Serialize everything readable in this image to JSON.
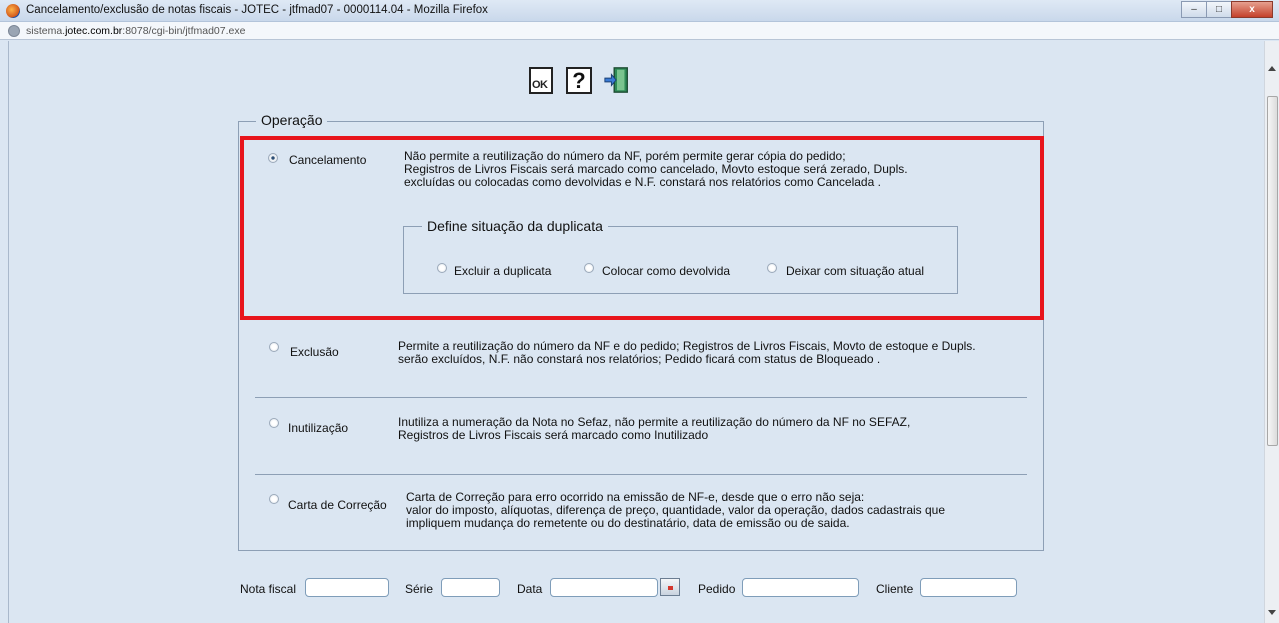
{
  "window": {
    "title": "Cancelamento/exclusão de notas fiscais - JOTEC - jtfmad07 - 0000114.04 - Mozilla Firefox",
    "url_prefix": "sistema.",
    "url_domain": "jotec.com.br",
    "url_suffix": ":8078/cgi-bin/jtfmad07.exe"
  },
  "toolbar": {
    "ok_label": "OK",
    "help_label": "?"
  },
  "operacao": {
    "legend": "Operação",
    "cancelamento": {
      "label": "Cancelamento",
      "checked": true,
      "desc": [
        "Não permite a reutilização do número da NF, porém permite gerar cópia do pedido;",
        "Registros de Livros Fiscais será marcado como cancelado, Movto estoque será zerado, Dupls.",
        "excluídas ou colocadas como devolvidas e N.F. constará nos relatórios como Cancelada ."
      ]
    },
    "duplicata": {
      "legend": "Define situação da duplicata",
      "options": [
        "Excluir a duplicata",
        "Colocar como devolvida",
        "Deixar com situação atual"
      ]
    },
    "exclusao": {
      "label": "Exclusão",
      "desc": [
        "Permite a reutilização do número da NF e do pedido; Registros de Livros Fiscais, Movto de estoque e Dupls.",
        "serão excluídos, N.F. não constará nos relatórios; Pedido ficará com status de Bloqueado ."
      ]
    },
    "inutilizacao": {
      "label": "Inutilização",
      "desc": [
        "Inutiliza a numeração da Nota no Sefaz, não permite a reutilização do número da NF no SEFAZ,",
        "Registros de Livros Fiscais será marcado como Inutilizado"
      ]
    },
    "carta": {
      "label": "Carta de Correção",
      "desc": [
        "Carta de Correção para erro ocorrido na emissão de NF-e, desde que o erro não seja:",
        "valor do imposto, alíquotas, diferença de preço, quantidade, valor da operação, dados cadastrais que",
        "impliquem mudança do remetente ou do destinatário, data de emissão ou de saida."
      ]
    }
  },
  "filters": {
    "nota_fiscal": "Nota fiscal",
    "serie": "Série",
    "data": "Data",
    "pedido": "Pedido",
    "cliente": "Cliente"
  }
}
